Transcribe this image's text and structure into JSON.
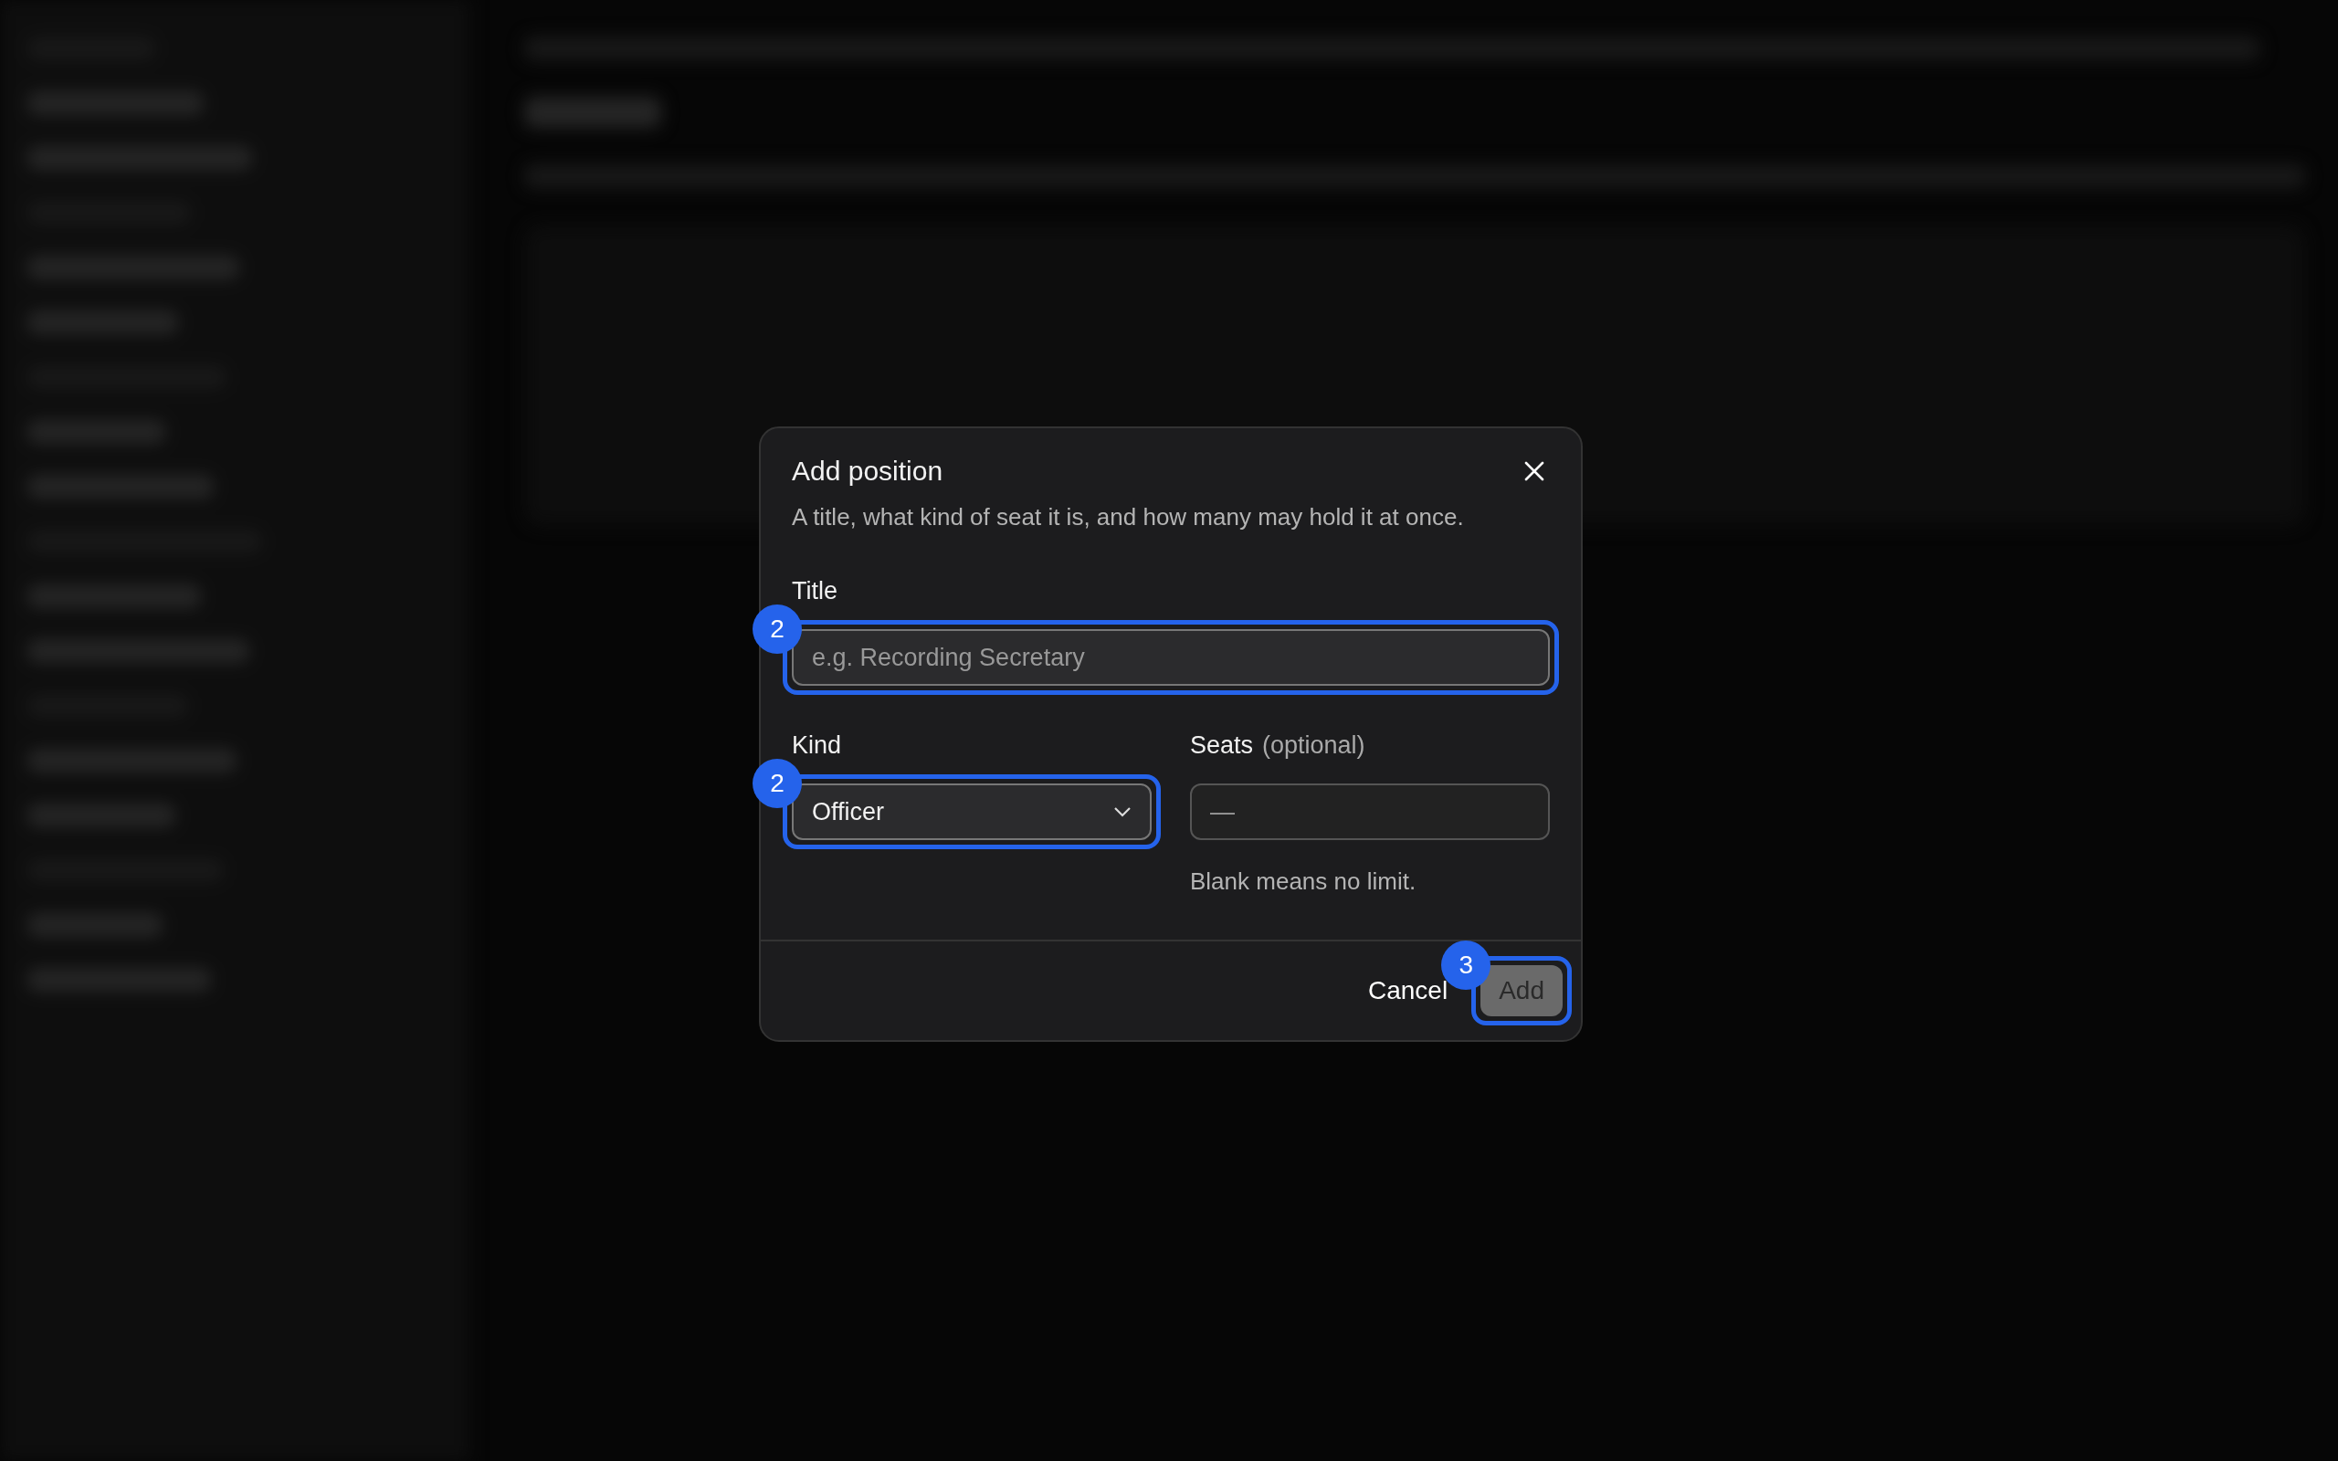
{
  "dialog": {
    "title": "Add position",
    "description": "A title, what kind of seat it is, and how many may hold it at once.",
    "title_field": {
      "label": "Title",
      "placeholder": "e.g. Recording Secretary",
      "annotation": "2"
    },
    "kind_field": {
      "label": "Kind",
      "value": "Officer",
      "annotation": "2"
    },
    "seats_field": {
      "label": "Seats",
      "label_note": "(optional)",
      "placeholder": "—",
      "help": "Blank means no limit."
    },
    "cancel_button": {
      "label": "Cancel"
    },
    "add_button": {
      "label": "Add",
      "disabled": true,
      "annotation": "3"
    }
  }
}
